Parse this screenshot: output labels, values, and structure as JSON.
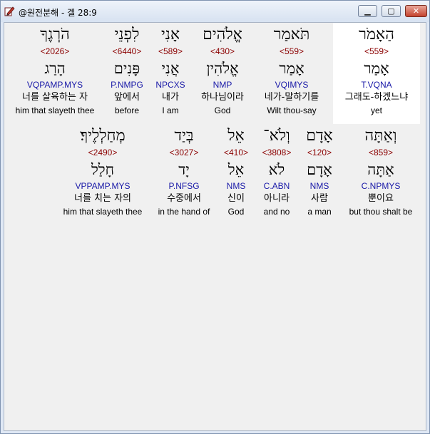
{
  "window": {
    "title": "@원전분해 - 겔 28:9",
    "app_icon": "pencil-book-icon",
    "controls": {
      "minimize": "▁",
      "maximize": "▢",
      "close": "✕"
    }
  },
  "rows": [
    {
      "words": [
        {
          "hebrew": "הַאָמֹר",
          "strong": "<559>",
          "lemma": "אָמַר",
          "morph": "T.VQNA",
          "korean": "그래도-하겠느냐",
          "english": "yet",
          "selected": true
        },
        {
          "hebrew": "תֹּאמַר",
          "strong": "<559>",
          "lemma": "אָמַר",
          "morph": "VQIMYS",
          "korean": "네가-말하기를",
          "english": "Wilt thou-say"
        },
        {
          "hebrew": "אֱלֹהִים",
          "strong": "<430>",
          "lemma": "אֱלֹהִין",
          "morph": "NMP",
          "korean": "하나님이라",
          "english": "God"
        },
        {
          "hebrew": "אָנִי",
          "strong": "<589>",
          "lemma": "אֲנִי",
          "morph": "NPCXS",
          "korean": "내가",
          "english": "I am"
        },
        {
          "hebrew": "לִפְנֵי",
          "strong": "<6440>",
          "lemma": "פָּנִים",
          "morph": "P.NMPG",
          "korean": "앞에서",
          "english": "before"
        },
        {
          "hebrew": "הֹרְגֶךָ",
          "strong": "<2026>",
          "lemma": "הָרַג",
          "morph": "VQPAMP.MYS",
          "korean": "너를 살육하는 자",
          "english": "him that slayeth thee"
        }
      ]
    },
    {
      "words": [
        {
          "hebrew": "וְאַתָּה",
          "strong": "<859>",
          "lemma": "אַתָּה",
          "morph": "C.NPMYS",
          "korean": "뿐이요",
          "english": "but thou shalt be"
        },
        {
          "hebrew": "אָדָם",
          "strong": "<120>",
          "lemma": "אָדָם",
          "morph": "NMS",
          "korean": "사람",
          "english": "a man"
        },
        {
          "hebrew": "וְלֹא־",
          "strong": "<3808>",
          "lemma": "לֹא",
          "morph": "C.ABN",
          "korean": "아니라",
          "english": "and no"
        },
        {
          "hebrew": "אֵל",
          "strong": "<410>",
          "lemma": "אֵל",
          "morph": "NMS",
          "korean": "신이",
          "english": "God"
        },
        {
          "hebrew": "בְּיַד",
          "strong": "<3027>",
          "lemma": "יָד",
          "morph": "P.NFSG",
          "korean": "수중에서",
          "english": "in the hand of"
        },
        {
          "hebrew": "מְחַלְלֶיךָ׃",
          "strong": "<2490>",
          "lemma": "חָלַל",
          "morph": "VPPAMP.MYS",
          "korean": "너를 치는 자의",
          "english": "him that slayeth thee"
        }
      ]
    }
  ]
}
